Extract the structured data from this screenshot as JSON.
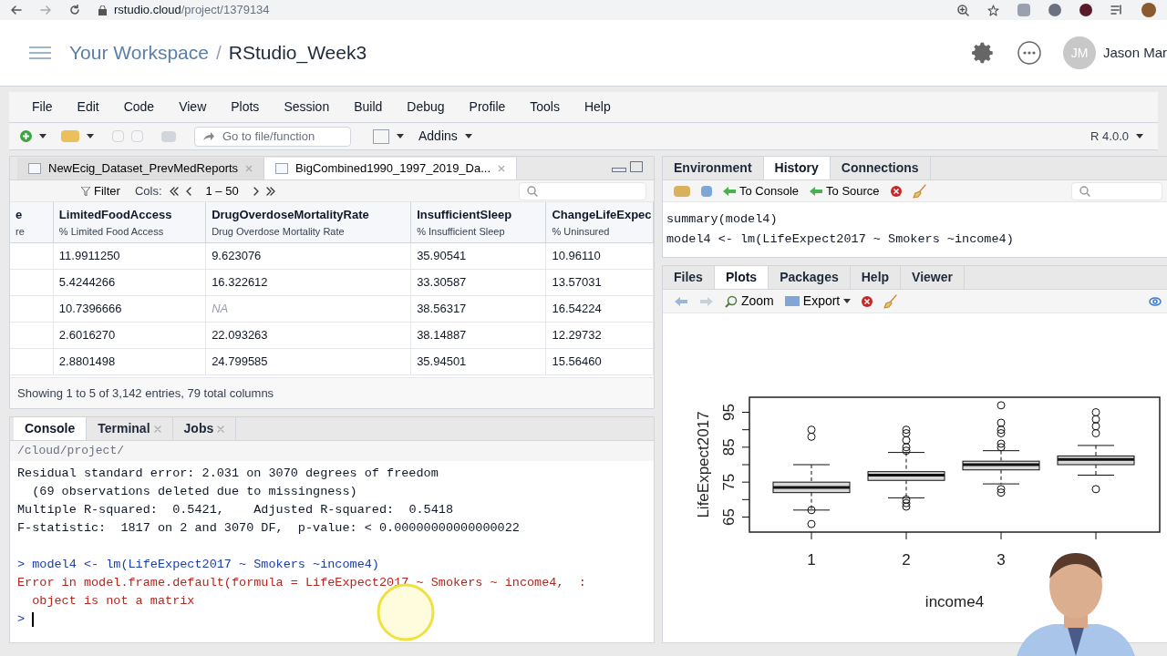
{
  "browser": {
    "url_host": "rstudio.cloud",
    "url_path": "/project/1379134"
  },
  "header": {
    "workspace": "Your Workspace",
    "separator": "/",
    "project": "RStudio_Week3",
    "user_initials": "JM",
    "user_name": "Jason Mar"
  },
  "menu": [
    "File",
    "Edit",
    "Code",
    "View",
    "Plots",
    "Session",
    "Build",
    "Debug",
    "Profile",
    "Tools",
    "Help"
  ],
  "toolbar": {
    "goto_placeholder": "Go to file/function",
    "addins": "Addins",
    "r_version": "R 4.0.0"
  },
  "source_tabs": [
    {
      "label": "NewEcig_Dataset_PrevMedReports",
      "selected": false
    },
    {
      "label": "BigCombined1990_1997_2019_Da...",
      "selected": true
    }
  ],
  "data_toolbar": {
    "filter": "Filter",
    "cols": "Cols:",
    "range": "1 – 50"
  },
  "table": {
    "columns": [
      {
        "name": "e",
        "label": "re"
      },
      {
        "name": "LimitedFoodAccess",
        "label": "% Limited Food Access"
      },
      {
        "name": "DrugOverdoseMortalityRate",
        "label": "Drug Overdose Mortality Rate"
      },
      {
        "name": "InsufficientSleep",
        "label": "% Insufficient Sleep"
      },
      {
        "name": "ChangeLifeExpec",
        "label": "% Uninsured"
      }
    ],
    "rows": [
      [
        "",
        "11.9911250",
        "9.623076",
        "35.90541",
        "10.96110"
      ],
      [
        "",
        "5.4244266",
        "16.322612",
        "33.30587",
        "13.57031"
      ],
      [
        "",
        "10.7396666",
        "NA",
        "38.56317",
        "16.54224"
      ],
      [
        "",
        "2.6016270",
        "22.093263",
        "38.14887",
        "12.29732"
      ],
      [
        "",
        "2.8801498",
        "24.799585",
        "35.94501",
        "15.56460"
      ]
    ],
    "footer": "Showing 1 to 5 of 3,142 entries, 79 total columns"
  },
  "console_tabs": [
    {
      "label": "Console",
      "selected": true,
      "closable": false
    },
    {
      "label": "Terminal",
      "selected": false,
      "closable": true
    },
    {
      "label": "Jobs",
      "selected": false,
      "closable": true
    }
  ],
  "console": {
    "path": "/cloud/project/",
    "lines": [
      {
        "kind": "output",
        "text": "Residual standard error: 2.031 on 3070 degrees of freedom"
      },
      {
        "kind": "output",
        "text": "  (69 observations deleted due to missingness)"
      },
      {
        "kind": "output",
        "text": "Multiple R-squared:  0.5421,\tAdjusted R-squared:  0.5418 "
      },
      {
        "kind": "output",
        "text": "F-statistic:  1817 on 2 and 3070 DF,  p-value: < 0.00000000000000022"
      },
      {
        "kind": "blank"
      },
      {
        "kind": "input",
        "text": "> model4 <- lm(LifeExpect2017 ~ Smokers ~income4)"
      },
      {
        "kind": "error",
        "text": "Error in model.frame.default(formula = LifeExpect2017 ~ Smokers ~ income4,  : "
      },
      {
        "kind": "error",
        "text": "  object is not a matrix"
      }
    ],
    "prompt": ">"
  },
  "env_tabs": [
    {
      "label": "Environment",
      "selected": false
    },
    {
      "label": "History",
      "selected": true
    },
    {
      "label": "Connections",
      "selected": false
    }
  ],
  "history_toolbar": {
    "to_console": "To Console",
    "to_source": "To Source"
  },
  "history": [
    "summary(model4)",
    "model4 <- lm(LifeExpect2017 ~ Smokers ~income4)"
  ],
  "files_tabs": [
    {
      "label": "Files",
      "selected": false
    },
    {
      "label": "Plots",
      "selected": true
    },
    {
      "label": "Packages",
      "selected": false
    },
    {
      "label": "Help",
      "selected": false
    },
    {
      "label": "Viewer",
      "selected": false
    }
  ],
  "plots_toolbar": {
    "zoom": "Zoom",
    "export": "Export"
  },
  "plot": {
    "ylabel": "LifeExpect2017",
    "xlabel": "income4",
    "yticks": [
      "65",
      "75",
      "85",
      "95"
    ],
    "xticks": [
      "1",
      "2",
      "3"
    ]
  }
}
